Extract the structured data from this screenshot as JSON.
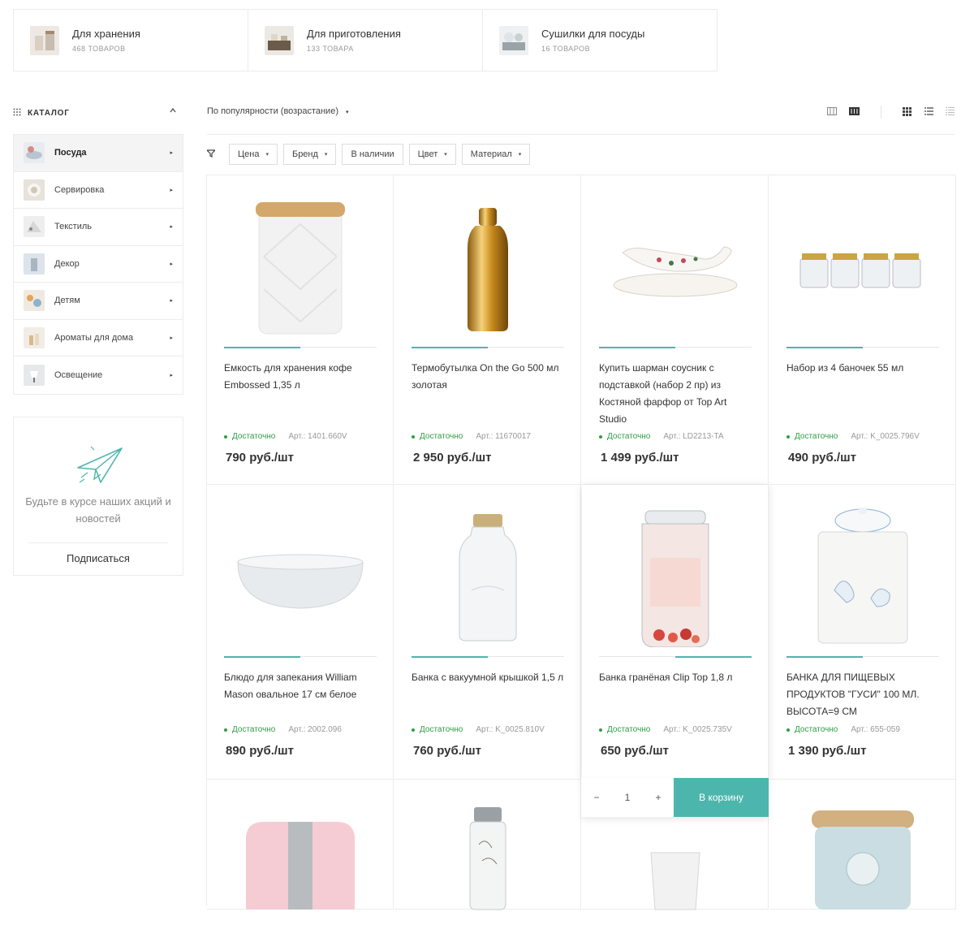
{
  "top_categories": [
    {
      "name": "Для хранения",
      "count": "468 ТОВАРОВ"
    },
    {
      "name": "Для приготовления",
      "count": "133 ТОВАРА"
    },
    {
      "name": "Сушилки для посуды",
      "count": "16 ТОВАРОВ"
    }
  ],
  "sidebar": {
    "title": "КАТАЛОГ",
    "items": [
      {
        "label": "Посуда"
      },
      {
        "label": "Сервировка"
      },
      {
        "label": "Текстиль"
      },
      {
        "label": "Декор"
      },
      {
        "label": "Детям"
      },
      {
        "label": "Ароматы для дома"
      },
      {
        "label": "Освещение"
      }
    ],
    "subscribe_text": "Будьте в курсе наших акций и новостей",
    "subscribe_button": "Подписаться"
  },
  "toolbar": {
    "sort_label": "По популярности (возрастание)",
    "filters": [
      "Цена",
      "Бренд",
      "В наличии",
      "Цвет",
      "Материал"
    ]
  },
  "products": [
    {
      "title": "Емкость для хранения кофе Embossed 1,35 л",
      "stock": "Достаточно",
      "sku": "Арт.: 1401.660V",
      "price": "790 руб./шт"
    },
    {
      "title": "Термобутылка On the Go 500 мл золотая",
      "stock": "Достаточно",
      "sku": "Арт.: 11670017",
      "price": "2 950 руб./шт"
    },
    {
      "title": "Купить шарман соусник с подставкой (набор 2 пр) из Костяной фарфор от Top Art Studio",
      "stock": "Достаточно",
      "sku": "Арт.: LD2213-TA",
      "price": "1 499 руб./шт"
    },
    {
      "title": "Набор из 4 баночек 55 мл",
      "stock": "Достаточно",
      "sku": "Арт.: K_0025.796V",
      "price": "490 руб./шт"
    },
    {
      "title": "Блюдо для запекания William Mason овальное 17 см белое",
      "stock": "Достаточно",
      "sku": "Арт.: 2002.096",
      "price": "890 руб./шт"
    },
    {
      "title": "Банка с вакуумной крышкой 1,5 л",
      "stock": "Достаточно",
      "sku": "Арт.: K_0025.810V",
      "price": "760 руб./шт"
    },
    {
      "title": "Банка гранёная Clip Top 1,8 л",
      "stock": "Достаточно",
      "sku": "Арт.: K_0025.735V",
      "price": "650 руб./шт"
    },
    {
      "title": "БАНКА ДЛЯ ПИЩЕВЫХ ПРОДУКТОВ \"ГУСИ\" 100 МЛ. ВЫСОТА=9 СМ",
      "stock": "Достаточно",
      "sku": "Арт.: 655-059",
      "price": "1 390 руб./шт"
    }
  ],
  "cart": {
    "qty": "1",
    "minus": "−",
    "plus": "+",
    "button": "В корзину"
  },
  "colors": {
    "accent": "#4db6ac",
    "stock": "#2e9e44",
    "border": "#ececec"
  }
}
